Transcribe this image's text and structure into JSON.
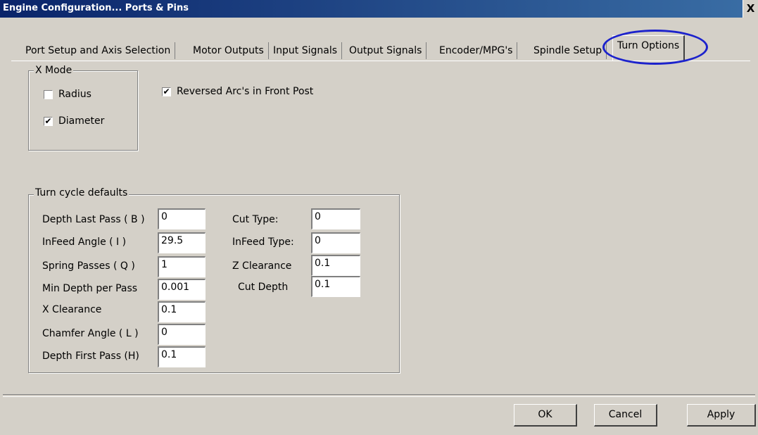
{
  "window": {
    "title": "Engine Configuration... Ports & Pins",
    "close_glyph": "X"
  },
  "tabs": [
    {
      "label": "Port Setup and Axis Selection"
    },
    {
      "label": "Motor Outputs"
    },
    {
      "label": "Input Signals"
    },
    {
      "label": "Output Signals"
    },
    {
      "label": "Encoder/MPG's"
    },
    {
      "label": "Spindle Setup"
    },
    {
      "label": "Turn Options",
      "active": true
    }
  ],
  "x_mode": {
    "legend": "X Mode",
    "radius": {
      "label": "Radius",
      "checked": false
    },
    "diameter": {
      "label": "Diameter",
      "checked": true
    }
  },
  "reversed_arcs": {
    "label": "Reversed Arc's in Front Post",
    "checked": true
  },
  "turn_cycle": {
    "legend": "Turn cycle defaults",
    "left": [
      {
        "label": "Depth Last Pass ( B )",
        "value": "0"
      },
      {
        "label": "InFeed Angle ( I )",
        "value": "29.5"
      },
      {
        "label": "Spring Passes ( Q )",
        "value": "1"
      },
      {
        "label": "Min Depth per Pass",
        "value": "0.001"
      },
      {
        "label": "X Clearance",
        "value": "0.1"
      },
      {
        "label": "Chamfer Angle ( L )",
        "value": "0"
      },
      {
        "label": "Depth First Pass (H)",
        "value": "0.1"
      }
    ],
    "right": [
      {
        "label": "Cut Type:",
        "value": "0"
      },
      {
        "label": "InFeed Type:",
        "value": "0"
      },
      {
        "label": "Z Clearance",
        "value": "0.1"
      },
      {
        "label": "Cut Depth",
        "value": "0.1"
      }
    ]
  },
  "buttons": {
    "ok": "OK",
    "cancel": "Cancel",
    "apply": "Apply"
  },
  "check_glyph": "✔",
  "colors": {
    "title_start": "#0a246a",
    "title_end": "#3a6ea5",
    "face": "#d4d0c8",
    "highlight_ellipse": "#1c22cc"
  }
}
